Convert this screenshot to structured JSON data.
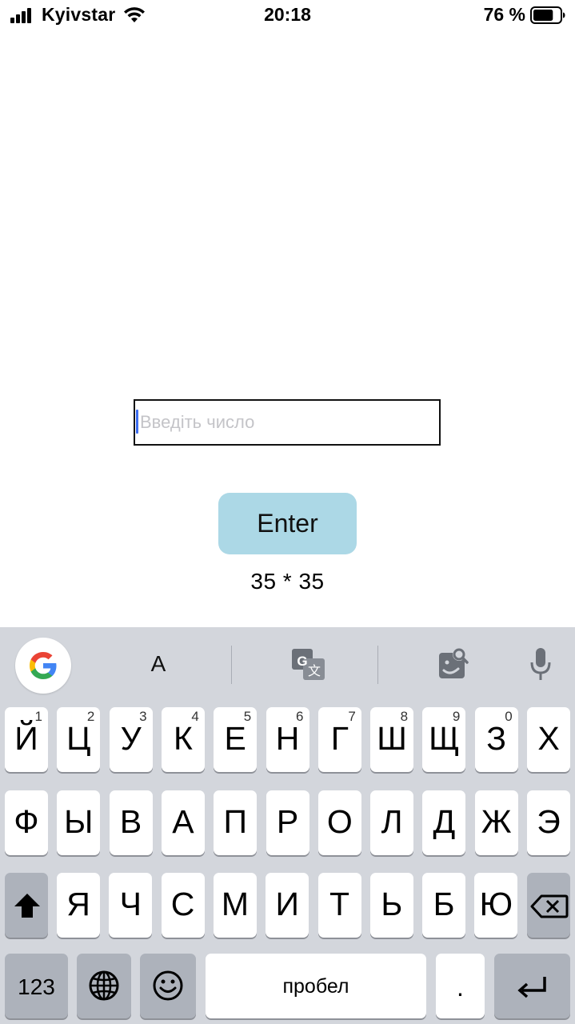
{
  "status_bar": {
    "carrier": "Kyivstar",
    "time": "20:18",
    "battery_percent": "76 %",
    "battery_level": 0.76
  },
  "form": {
    "input_placeholder": "Введіть число",
    "input_value": "",
    "enter_label": "Enter",
    "result": "35 *  35"
  },
  "keyboard": {
    "toolbar": {
      "text_label": "A",
      "icons": [
        "google-logo-icon",
        "translate-icon",
        "image-search-icon",
        "microphone-icon"
      ]
    },
    "row1": [
      {
        "letter": "Й",
        "hint": "1"
      },
      {
        "letter": "Ц",
        "hint": "2"
      },
      {
        "letter": "У",
        "hint": "3"
      },
      {
        "letter": "К",
        "hint": "4"
      },
      {
        "letter": "Е",
        "hint": "5"
      },
      {
        "letter": "Н",
        "hint": "6"
      },
      {
        "letter": "Г",
        "hint": "7"
      },
      {
        "letter": "Ш",
        "hint": "8"
      },
      {
        "letter": "Щ",
        "hint": "9"
      },
      {
        "letter": "З",
        "hint": "0"
      },
      {
        "letter": "Х",
        "hint": ""
      }
    ],
    "row2": [
      "Ф",
      "Ы",
      "В",
      "А",
      "П",
      "Р",
      "О",
      "Л",
      "Д",
      "Ж",
      "Э"
    ],
    "row3": [
      "Я",
      "Ч",
      "С",
      "М",
      "И",
      "Т",
      "Ь",
      "Б",
      "Ю"
    ],
    "numbers_label": "123",
    "space_label": "пробел",
    "period_label": "."
  },
  "colors": {
    "enter_button": "#acd8e6",
    "keyboard_bg": "#d3d6dc",
    "caret": "#3b6cf0"
  }
}
